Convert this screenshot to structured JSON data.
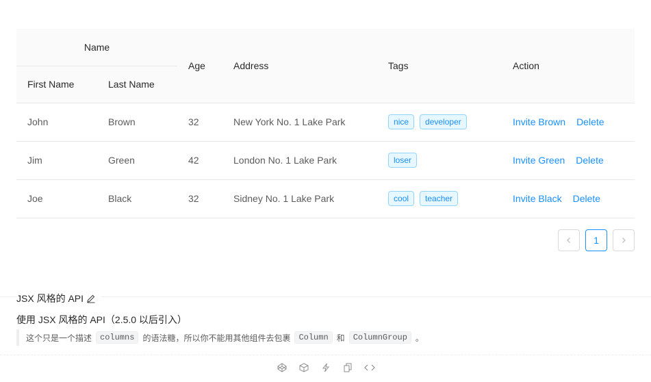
{
  "table": {
    "headers": {
      "name_group": "Name",
      "first_name": "First Name",
      "last_name": "Last Name",
      "age": "Age",
      "address": "Address",
      "tags": "Tags",
      "action": "Action"
    },
    "rows": [
      {
        "first": "John",
        "last": "Brown",
        "age": "32",
        "address": "New York No. 1 Lake Park",
        "tags": [
          "nice",
          "developer"
        ],
        "invite": "Invite Brown",
        "delete": "Delete"
      },
      {
        "first": "Jim",
        "last": "Green",
        "age": "42",
        "address": "London No. 1 Lake Park",
        "tags": [
          "loser"
        ],
        "invite": "Invite Green",
        "delete": "Delete"
      },
      {
        "first": "Joe",
        "last": "Black",
        "age": "32",
        "address": "Sidney No. 1 Lake Park",
        "tags": [
          "cool",
          "teacher"
        ],
        "invite": "Invite Black",
        "delete": "Delete"
      }
    ]
  },
  "pagination": {
    "prev": "‹",
    "current": "1",
    "next": "›"
  },
  "demo": {
    "title": "JSX 风格的 API",
    "description_title": "使用 JSX 风格的 API（2.5.0 以后引入）",
    "quote_prefix": "这个只是一个描述",
    "code_columns": "columns",
    "quote_middle": "的语法糖，所以你不能用其他组件去包裹",
    "code_column": "Column",
    "quote_and": "和",
    "code_column_group": "ColumnGroup",
    "quote_end": "。"
  },
  "colors": {
    "accent": "#1890ff",
    "tag_bg": "#e6f7ff",
    "tag_border": "#91d5ff",
    "header_bg": "#fafafa"
  },
  "icons": [
    "codepen-icon",
    "codesandbox-icon",
    "thunderbolt-icon",
    "copy-icon",
    "code-icon",
    "edit-icon"
  ]
}
